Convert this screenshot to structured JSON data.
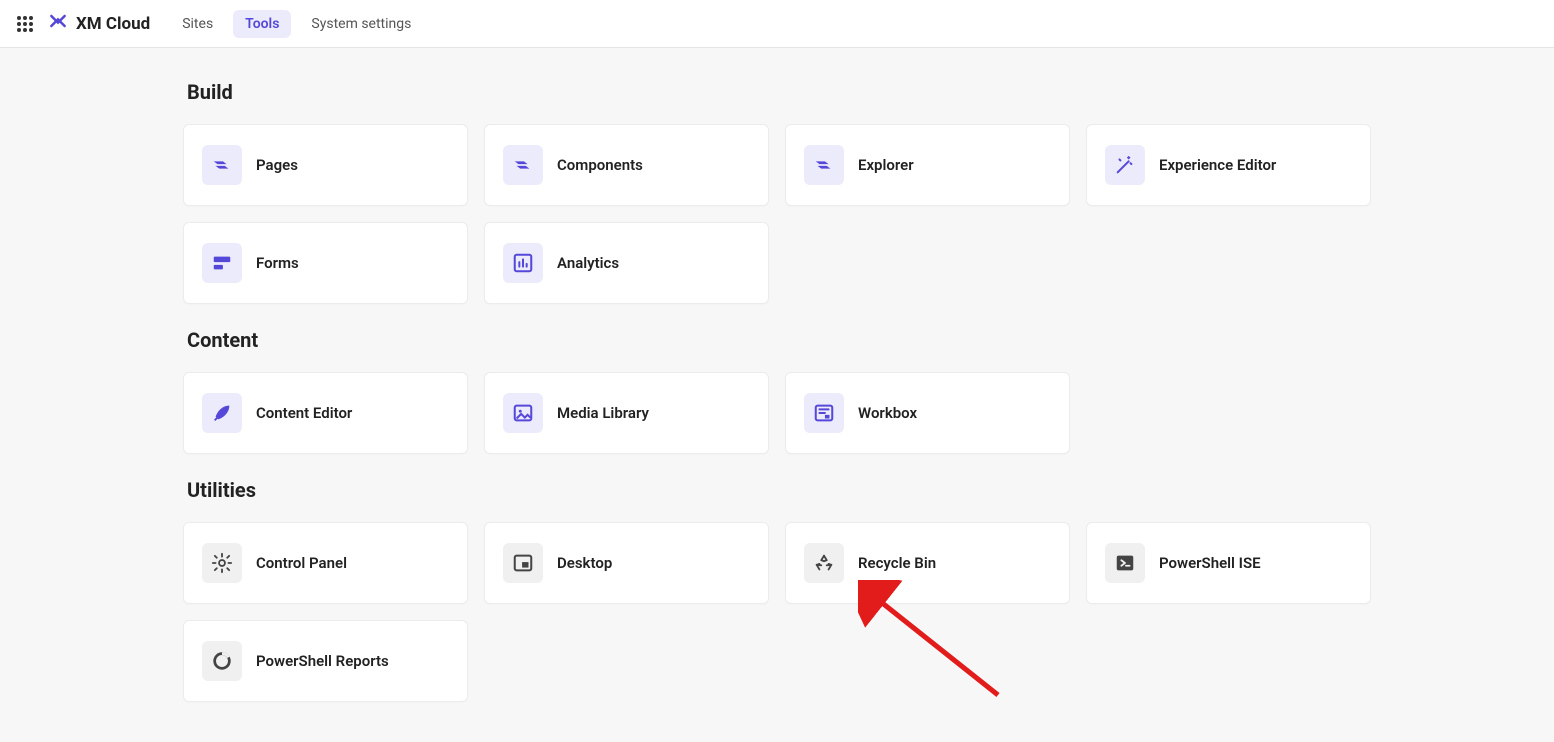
{
  "header": {
    "brand": "XM Cloud",
    "nav": [
      {
        "label": "Sites",
        "active": false
      },
      {
        "label": "Tools",
        "active": true
      },
      {
        "label": "System settings",
        "active": false
      }
    ]
  },
  "sections": {
    "build": {
      "title": "Build",
      "cards": [
        {
          "label": "Pages",
          "icon": "layers-icon",
          "tone": "purple"
        },
        {
          "label": "Components",
          "icon": "layers-icon",
          "tone": "purple"
        },
        {
          "label": "Explorer",
          "icon": "layers-icon",
          "tone": "purple"
        },
        {
          "label": "Experience Editor",
          "icon": "wand-icon",
          "tone": "purple"
        },
        {
          "label": "Forms",
          "icon": "form-icon",
          "tone": "purple"
        },
        {
          "label": "Analytics",
          "icon": "chart-icon",
          "tone": "purple"
        }
      ]
    },
    "content": {
      "title": "Content",
      "cards": [
        {
          "label": "Content Editor",
          "icon": "quill-icon",
          "tone": "purple"
        },
        {
          "label": "Media Library",
          "icon": "image-icon",
          "tone": "purple"
        },
        {
          "label": "Workbox",
          "icon": "workbox-icon",
          "tone": "purple"
        }
      ]
    },
    "utilities": {
      "title": "Utilities",
      "cards": [
        {
          "label": "Control Panel",
          "icon": "gear-icon",
          "tone": "gray"
        },
        {
          "label": "Desktop",
          "icon": "desktop-icon",
          "tone": "gray"
        },
        {
          "label": "Recycle Bin",
          "icon": "recycle-icon",
          "tone": "gray"
        },
        {
          "label": "PowerShell ISE",
          "icon": "terminal-icon",
          "tone": "gray"
        },
        {
          "label": "PowerShell Reports",
          "icon": "ring-icon",
          "tone": "gray"
        }
      ]
    }
  }
}
